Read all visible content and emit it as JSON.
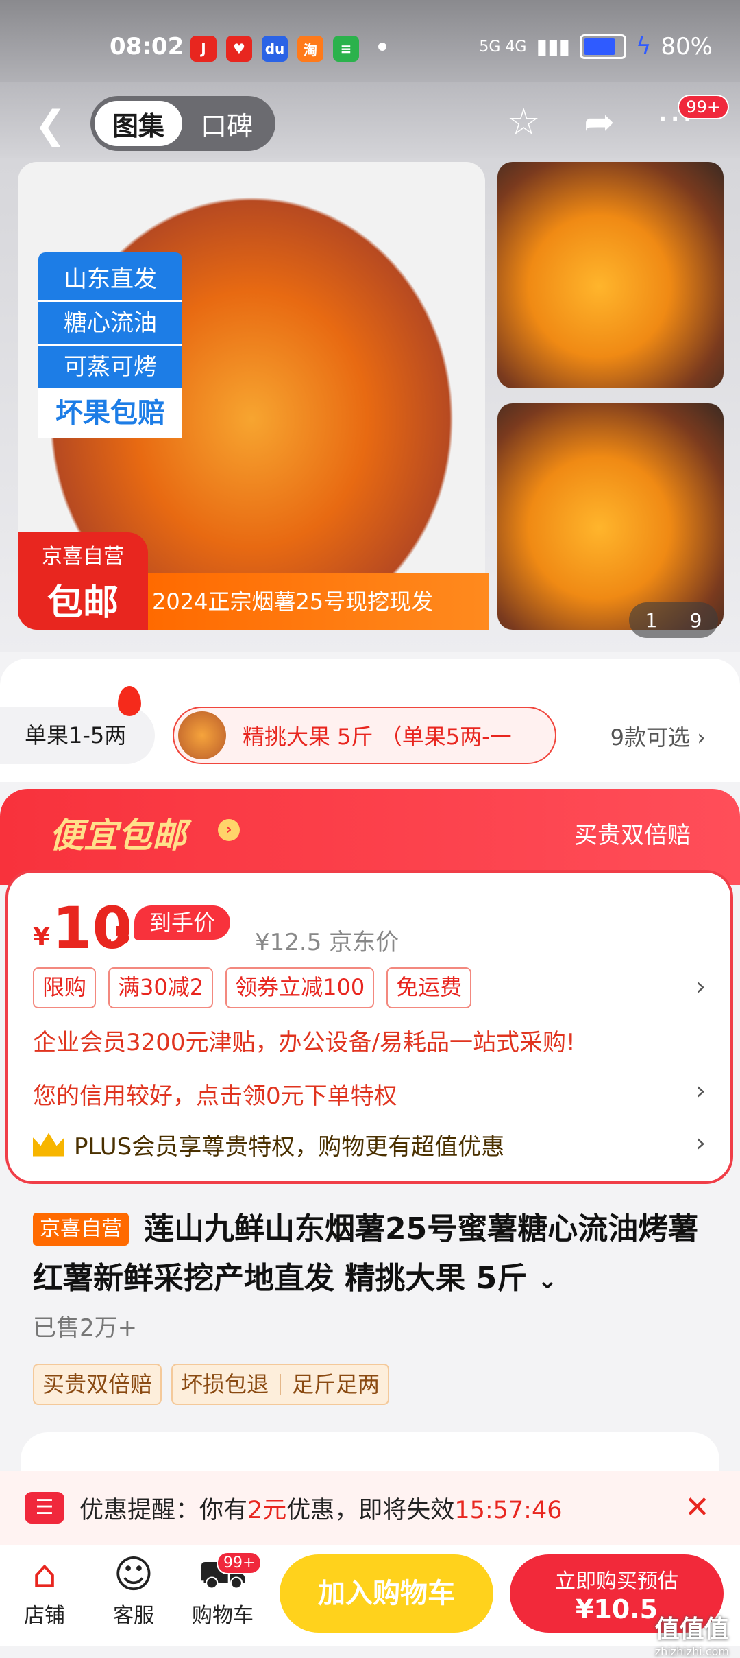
{
  "status_bar": {
    "time": "08:02",
    "apps": [
      "jd-app-icon",
      "jd-heart-icon",
      "baidu-icon",
      "taobao-icon",
      "message-icon"
    ],
    "network": "5G 4G",
    "battery": "80%"
  },
  "nav": {
    "tabs": [
      "图集",
      "口碑"
    ],
    "active_tab": "图集",
    "more_badge": "99+"
  },
  "gallery": {
    "tags": [
      "山东直发",
      "糖心流油",
      "可蒸可烤"
    ],
    "tag_highlight": "坏果包赔",
    "corner_top": "京喜自营",
    "corner_bottom": "包邮",
    "strip": "2024正宗烟薯25号现挖现发",
    "counter_current": "1",
    "counter_total": "9"
  },
  "variants": {
    "chip1": "单果1-5两",
    "chip2": "精挑大果 5斤 （单果5两-一",
    "more": "9款可选"
  },
  "promo": {
    "title": "便宜包邮",
    "right": "买贵双倍赔",
    "price_symbol": "¥",
    "price_int": "10",
    "price_dec": ".5",
    "price_tag": "到手价",
    "original": "¥12.5 京东价",
    "coupons": [
      "限购",
      "满30减2",
      "领券立减100",
      "免运费"
    ],
    "enterprise": "企业会员3200元津贴，办公设备/易耗品一站式采购!",
    "credit": "您的信用较好，点击领0元下单特权",
    "plus": "PLUS会员享尊贵特权，购物更有超值优惠"
  },
  "product": {
    "badge": "京喜自营",
    "title": "莲山九鲜山东烟薯25号蜜薯糖心流油烤薯红薯新鲜采挖产地直发 精挑大果 5斤",
    "sold": "已售2万+",
    "services": [
      "买贵双倍赔",
      "坏损包退",
      "足斤足两"
    ]
  },
  "reminder": {
    "prefix": "优惠提醒：你有",
    "amount": "2元",
    "middle": "优惠，即将失效",
    "countdown": "15:57:46"
  },
  "bottom_bar": {
    "store": "店铺",
    "service": "客服",
    "cart": "购物车",
    "cart_badge": "99+",
    "add_cart": "加入购物车",
    "buy_line1": "立即购买预估",
    "buy_line2": "¥10.5"
  },
  "watermark": {
    "text": "值值值",
    "sub": "zhizhizhi.com"
  },
  "colors": {
    "accent_red": "#f2293a",
    "yellow_button": "#ffd21c",
    "orange_badge": "#ff6a00",
    "blue_tag": "#1d7de6"
  }
}
